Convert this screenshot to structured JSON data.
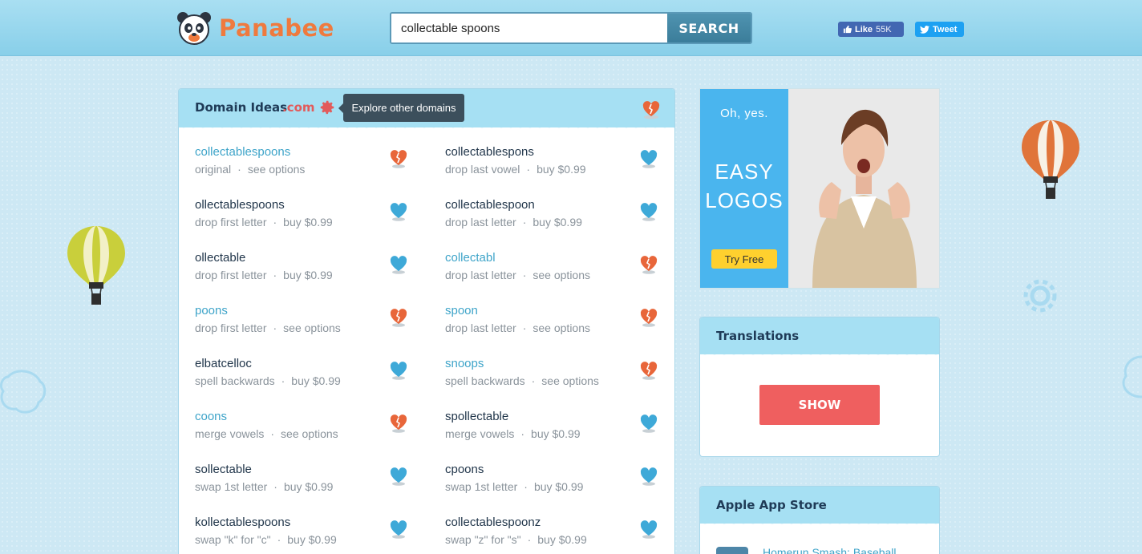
{
  "header": {
    "brand": "Panabee",
    "search_value": "collectable spoons",
    "search_button": "SEARCH",
    "fb_like_label": "Like",
    "fb_like_count": "55K",
    "tweet_label": "Tweet"
  },
  "domain_panel": {
    "title": "Domain Ideas",
    "tld": ".com",
    "tooltip": "Explore other domains",
    "items": [
      {
        "name": "collectablespoons",
        "method": "original",
        "action": "see options",
        "available": true
      },
      {
        "name": "collectablespons",
        "method": "drop last vowel",
        "action": "buy $0.99",
        "available": false
      },
      {
        "name": "ollectablespoons",
        "method": "drop first letter",
        "action": "buy $0.99",
        "available": false
      },
      {
        "name": "collectablespoon",
        "method": "drop last letter",
        "action": "buy $0.99",
        "available": false
      },
      {
        "name": "ollectable",
        "method": "drop first letter",
        "action": "buy $0.99",
        "available": false
      },
      {
        "name": "collectabl",
        "method": "drop last letter",
        "action": "see options",
        "available": true
      },
      {
        "name": "poons",
        "method": "drop first letter",
        "action": "see options",
        "available": true
      },
      {
        "name": "spoon",
        "method": "drop last letter",
        "action": "see options",
        "available": true
      },
      {
        "name": "elbatcelloc",
        "method": "spell backwards",
        "action": "buy $0.99",
        "available": false
      },
      {
        "name": "snoops",
        "method": "spell backwards",
        "action": "see options",
        "available": true
      },
      {
        "name": "coons",
        "method": "merge vowels",
        "action": "see options",
        "available": true
      },
      {
        "name": "spollectable",
        "method": "merge vowels",
        "action": "buy $0.99",
        "available": false
      },
      {
        "name": "sollectable",
        "method": "swap 1st letter",
        "action": "buy $0.99",
        "available": false
      },
      {
        "name": "cpoons",
        "method": "swap 1st letter",
        "action": "buy $0.99",
        "available": false
      },
      {
        "name": "kollectablespoons",
        "method": "swap \"k\" for \"c\"",
        "action": "buy $0.99",
        "available": false
      },
      {
        "name": "collectablespoonz",
        "method": "swap \"z\" for \"s\"",
        "action": "buy $0.99",
        "available": false
      }
    ]
  },
  "ad": {
    "tagline": "Oh, yes.",
    "headline_1": "EASY",
    "headline_2": "LOGOS",
    "cta": "Try Free"
  },
  "translations": {
    "title": "Translations",
    "button": "SHOW"
  },
  "app_store": {
    "title": "Apple App Store",
    "app_name": "Homerun Smash: Baseball"
  },
  "colors": {
    "available_heart": "#e8663a",
    "taken_heart": "#3ea9d8",
    "brand": "#ef7a3e",
    "accent_red": "#ef5f5f"
  }
}
